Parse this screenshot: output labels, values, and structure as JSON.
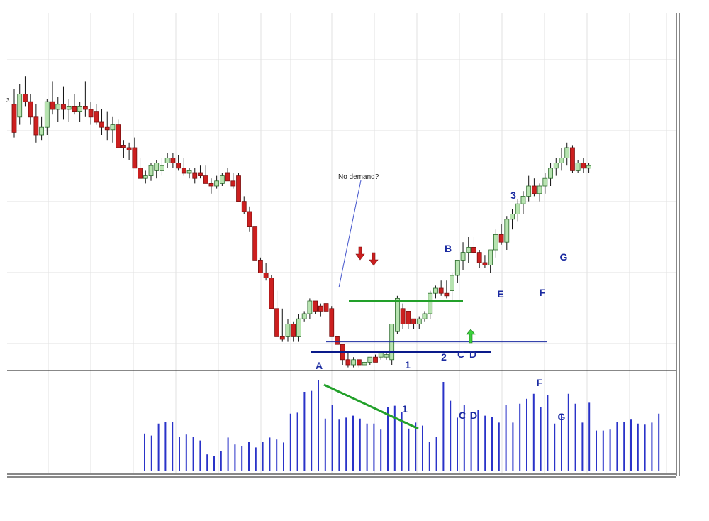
{
  "chart_data": [
    {
      "type": "candlestick",
      "panel": "price",
      "grid": true,
      "ylim": [
        0,
        100
      ],
      "axis_label_visible": "3",
      "up_color": "#b7e3b0",
      "down_color": "#cc1f1f",
      "candles": [
        {
          "o": 87,
          "h": 93,
          "l": 74,
          "c": 76
        },
        {
          "o": 82,
          "h": 95,
          "l": 79,
          "c": 91
        },
        {
          "o": 91,
          "h": 98,
          "l": 86,
          "c": 88
        },
        {
          "o": 88,
          "h": 91,
          "l": 79,
          "c": 82
        },
        {
          "o": 82,
          "h": 87,
          "l": 72,
          "c": 75
        },
        {
          "o": 75,
          "h": 82,
          "l": 73,
          "c": 78
        },
        {
          "o": 78,
          "h": 89,
          "l": 75,
          "c": 88
        },
        {
          "o": 88,
          "h": 96,
          "l": 83,
          "c": 85
        },
        {
          "o": 85,
          "h": 90,
          "l": 80,
          "c": 87
        },
        {
          "o": 87,
          "h": 94,
          "l": 81,
          "c": 85
        },
        {
          "o": 85,
          "h": 89,
          "l": 80,
          "c": 86
        },
        {
          "o": 86,
          "h": 91,
          "l": 83,
          "c": 84
        },
        {
          "o": 84,
          "h": 88,
          "l": 80,
          "c": 86
        },
        {
          "o": 86,
          "h": 96,
          "l": 82,
          "c": 85
        },
        {
          "o": 85,
          "h": 88,
          "l": 79,
          "c": 82
        },
        {
          "o": 84,
          "h": 87,
          "l": 79,
          "c": 80
        },
        {
          "o": 80,
          "h": 85,
          "l": 75,
          "c": 78
        },
        {
          "o": 78,
          "h": 84,
          "l": 73,
          "c": 77
        },
        {
          "o": 77,
          "h": 82,
          "l": 72,
          "c": 79
        },
        {
          "o": 79,
          "h": 81,
          "l": 71,
          "c": 70
        },
        {
          "o": 71,
          "h": 73,
          "l": 66,
          "c": 70
        },
        {
          "o": 70,
          "h": 72,
          "l": 65,
          "c": 69
        },
        {
          "o": 70,
          "h": 74,
          "l": 63,
          "c": 62
        },
        {
          "o": 62,
          "h": 66,
          "l": 59,
          "c": 58
        },
        {
          "o": 58,
          "h": 61,
          "l": 56,
          "c": 59
        },
        {
          "o": 59,
          "h": 64,
          "l": 57,
          "c": 63
        },
        {
          "o": 61,
          "h": 65,
          "l": 58,
          "c": 64
        },
        {
          "o": 61,
          "h": 66,
          "l": 59,
          "c": 63
        },
        {
          "o": 64,
          "h": 68,
          "l": 62,
          "c": 66
        },
        {
          "o": 66,
          "h": 68,
          "l": 62,
          "c": 64
        },
        {
          "o": 64,
          "h": 67,
          "l": 61,
          "c": 62
        },
        {
          "o": 62,
          "h": 66,
          "l": 59,
          "c": 60
        },
        {
          "o": 60,
          "h": 62,
          "l": 58,
          "c": 61
        },
        {
          "o": 60,
          "h": 62,
          "l": 56,
          "c": 58
        },
        {
          "o": 60,
          "h": 63,
          "l": 58,
          "c": 59
        },
        {
          "o": 59,
          "h": 63,
          "l": 57,
          "c": 56
        },
        {
          "o": 56,
          "h": 58,
          "l": 52,
          "c": 55
        },
        {
          "o": 55,
          "h": 59,
          "l": 54,
          "c": 57
        },
        {
          "o": 56,
          "h": 60,
          "l": 55,
          "c": 59
        },
        {
          "o": 60,
          "h": 62,
          "l": 57,
          "c": 57
        },
        {
          "o": 57,
          "h": 60,
          "l": 54,
          "c": 55
        },
        {
          "o": 59,
          "h": 60,
          "l": 49,
          "c": 49
        },
        {
          "o": 49,
          "h": 51,
          "l": 44,
          "c": 45
        },
        {
          "o": 45,
          "h": 47,
          "l": 37,
          "c": 39
        },
        {
          "o": 39,
          "h": 39,
          "l": 33,
          "c": 26
        },
        {
          "o": 26,
          "h": 27,
          "l": 22,
          "c": 21
        },
        {
          "o": 21,
          "h": 25,
          "l": 18,
          "c": 19
        },
        {
          "o": 19,
          "h": 20,
          "l": 13,
          "c": 7
        },
        {
          "o": 7,
          "h": 14,
          "l": 0,
          "c": -4
        },
        {
          "o": -4,
          "h": 7,
          "l": -6,
          "c": -5
        },
        {
          "o": -4,
          "h": 3,
          "l": -6,
          "c": 1
        },
        {
          "o": 1,
          "h": 2,
          "l": -6,
          "c": -4
        },
        {
          "o": -4,
          "h": 5,
          "l": -6,
          "c": 3
        },
        {
          "o": 3,
          "h": 6,
          "l": 2,
          "c": 5
        },
        {
          "o": 5,
          "h": 11,
          "l": 3,
          "c": 10
        },
        {
          "o": 10,
          "h": 10,
          "l": 5,
          "c": 6
        },
        {
          "o": 8,
          "h": 9,
          "l": 4,
          "c": 6
        },
        {
          "o": 9,
          "h": 9,
          "l": 7,
          "c": 6
        },
        {
          "o": 7,
          "h": 8,
          "l": -3,
          "c": -4
        },
        {
          "o": -4,
          "h": -3,
          "l": -7,
          "c": -7
        },
        {
          "o": -7,
          "h": -7,
          "l": -15,
          "c": -13
        },
        {
          "o": -13,
          "h": -10,
          "l": -16,
          "c": -15
        },
        {
          "o": -15,
          "h": -12,
          "l": -16,
          "c": -13
        },
        {
          "o": -13,
          "h": -13,
          "l": -16,
          "c": -15
        },
        {
          "o": -15,
          "h": -14,
          "l": -15,
          "c": -14
        },
        {
          "o": -14,
          "h": -12,
          "l": -15,
          "c": -12
        },
        {
          "o": -12,
          "h": -11,
          "l": -14,
          "c": -14
        },
        {
          "o": -12,
          "h": -10,
          "l": -13,
          "c": -10
        },
        {
          "o": -12,
          "h": -10,
          "l": -13,
          "c": -11
        },
        {
          "o": -13,
          "h": -10,
          "l": -15,
          "c": 1
        },
        {
          "o": -2,
          "h": 12,
          "l": -3,
          "c": 11
        },
        {
          "o": 7,
          "h": 9,
          "l": -1,
          "c": 1
        },
        {
          "o": 6,
          "h": 6,
          "l": -1,
          "c": 1
        },
        {
          "o": 3,
          "h": 3,
          "l": -1,
          "c": 1
        },
        {
          "o": 1,
          "h": 4,
          "l": -1,
          "c": 3
        },
        {
          "o": 3,
          "h": 6,
          "l": 2,
          "c": 5
        },
        {
          "o": 5,
          "h": 14,
          "l": 3,
          "c": 13
        },
        {
          "o": 13,
          "h": 16,
          "l": 11,
          "c": 15
        },
        {
          "o": 15,
          "h": 18,
          "l": 12,
          "c": 13
        },
        {
          "o": 13,
          "h": 18,
          "l": 11,
          "c": 12
        },
        {
          "o": 14,
          "h": 21,
          "l": 10,
          "c": 20
        },
        {
          "o": 20,
          "h": 24,
          "l": 17,
          "c": 26
        },
        {
          "o": 26,
          "h": 33,
          "l": 22,
          "c": 29
        },
        {
          "o": 29,
          "h": 35,
          "l": 25,
          "c": 31
        },
        {
          "o": 31,
          "h": 35,
          "l": 28,
          "c": 29
        },
        {
          "o": 29,
          "h": 30,
          "l": 23,
          "c": 25
        },
        {
          "o": 25,
          "h": 28,
          "l": 23,
          "c": 24
        },
        {
          "o": 24,
          "h": 30,
          "l": 21,
          "c": 30
        },
        {
          "o": 30,
          "h": 38,
          "l": 27,
          "c": 36
        },
        {
          "o": 36,
          "h": 40,
          "l": 32,
          "c": 33
        },
        {
          "o": 33,
          "h": 43,
          "l": 30,
          "c": 42
        },
        {
          "o": 42,
          "h": 46,
          "l": 38,
          "c": 44
        },
        {
          "o": 44,
          "h": 50,
          "l": 41,
          "c": 48
        },
        {
          "o": 48,
          "h": 53,
          "l": 44,
          "c": 51
        },
        {
          "o": 51,
          "h": 59,
          "l": 49,
          "c": 55
        },
        {
          "o": 55,
          "h": 58,
          "l": 51,
          "c": 52
        },
        {
          "o": 52,
          "h": 56,
          "l": 49,
          "c": 55
        },
        {
          "o": 55,
          "h": 60,
          "l": 52,
          "c": 58
        },
        {
          "o": 58,
          "h": 64,
          "l": 55,
          "c": 62
        },
        {
          "o": 62,
          "h": 66,
          "l": 59,
          "c": 64
        },
        {
          "o": 64,
          "h": 70,
          "l": 61,
          "c": 66
        },
        {
          "o": 66,
          "h": 72,
          "l": 63,
          "c": 70
        },
        {
          "o": 70,
          "h": 71,
          "l": 60,
          "c": 61
        },
        {
          "o": 61,
          "h": 65,
          "l": 60,
          "c": 64
        },
        {
          "o": 64,
          "h": 66,
          "l": 60,
          "c": 62
        },
        {
          "o": 62,
          "h": 64,
          "l": 60,
          "c": 63
        }
      ],
      "levels": [
        {
          "name": "upper-resistance",
          "value": 10,
          "color": "#22a02a"
        },
        {
          "name": "mid-line",
          "value": -6,
          "color": "#1a2aa0"
        },
        {
          "name": "support",
          "value": -10,
          "color": "#0a1a8a"
        }
      ],
      "annotations": [
        {
          "text": "No demand?",
          "color": "#222222",
          "size": 10
        },
        {
          "text": "A",
          "color": "#1a2aa0",
          "size": 14
        },
        {
          "text": "1",
          "color": "#1a2aa0",
          "size": 14
        },
        {
          "text": "2",
          "color": "#1a2aa0",
          "size": 14
        },
        {
          "text": "B",
          "color": "#1a2aa0",
          "size": 14
        },
        {
          "text": "C",
          "color": "#1a2aa0",
          "size": 14
        },
        {
          "text": "D",
          "color": "#1a2aa0",
          "size": 14
        },
        {
          "text": "E",
          "color": "#1a2aa0",
          "size": 14
        },
        {
          "text": "F",
          "color": "#1a2aa0",
          "size": 14
        },
        {
          "text": "G",
          "color": "#1a2aa0",
          "size": 14
        },
        {
          "text": "3",
          "color": "#1a2aa0",
          "size": 14
        }
      ]
    },
    {
      "type": "bar",
      "panel": "volume",
      "ylim": [
        0,
        100
      ],
      "color": "#2a33c8",
      "values": [
        38,
        36,
        48,
        50,
        50,
        35,
        37,
        35,
        31,
        17,
        15,
        20,
        34,
        27,
        25,
        30,
        24,
        30,
        34,
        32,
        29,
        58,
        59,
        80,
        81,
        92,
        53,
        67,
        52,
        54,
        56,
        53,
        48,
        48,
        42,
        65,
        66,
        60,
        43,
        49,
        46,
        30,
        35,
        90,
        71,
        54,
        67,
        60,
        62,
        56,
        55,
        49,
        67,
        49,
        68,
        73,
        78,
        65,
        77,
        48,
        57,
        78,
        68,
        49,
        69,
        41,
        41,
        42,
        50,
        50,
        52,
        48,
        47,
        49,
        58
      ],
      "annotations": [
        {
          "text": "A"
        },
        {
          "text": "1"
        },
        {
          "text": "C"
        },
        {
          "text": "D"
        },
        {
          "text": "F"
        },
        {
          "text": "G"
        }
      ]
    }
  ]
}
